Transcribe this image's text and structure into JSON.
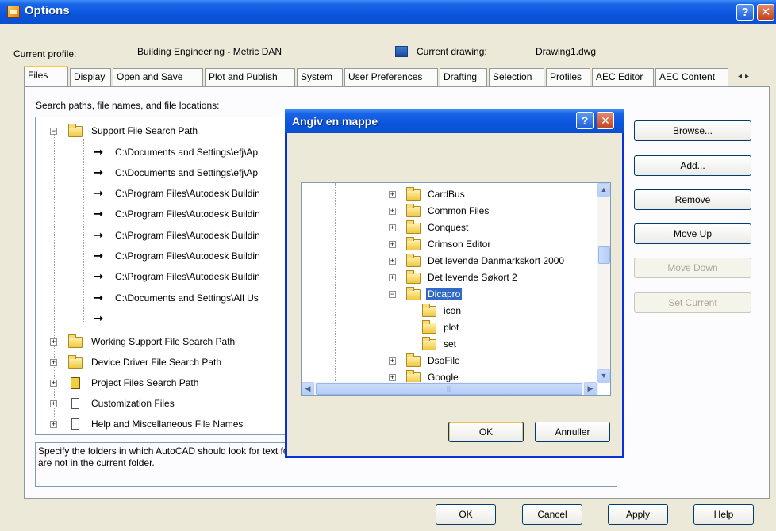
{
  "window": {
    "title": "Options"
  },
  "titlebar_buttons": {
    "help": "?",
    "close": "✕"
  },
  "profile": {
    "label": "Current profile:",
    "value": "Building Engineering - Metric DAN",
    "drawing_label": "Current drawing:",
    "drawing_value": "Drawing1.dwg"
  },
  "tabs": [
    "Files",
    "Display",
    "Open and Save",
    "Plot and Publish",
    "System",
    "User Preferences",
    "Drafting",
    "Selection",
    "Profiles",
    "AEC Editor",
    "AEC Content"
  ],
  "active_tab": "Files",
  "tab_scroll": {
    "left": "◂",
    "right": "▸"
  },
  "files": {
    "label": "Search paths, file names, and file locations:",
    "tree": {
      "support": {
        "label": "Support File Search Path",
        "paths": [
          "C:\\Documents and Settings\\efj\\Ap",
          "C:\\Documents and Settings\\efj\\Ap",
          "C:\\Program Files\\Autodesk Buildin",
          "C:\\Program Files\\Autodesk Buildin",
          "C:\\Program Files\\Autodesk Buildin",
          "C:\\Program Files\\Autodesk Buildin",
          "C:\\Program Files\\Autodesk Buildin",
          "C:\\Documents and Settings\\All Us",
          ""
        ]
      },
      "nodes": [
        "Working Support File Search Path",
        "Device Driver File Search Path",
        "Project Files Search Path",
        "Customization Files",
        "Help and Miscellaneous File Names"
      ]
    },
    "description": "Specify the folders in which AutoCAD should look for text fonts, menus, plug-ins, drawings to insert, linetypes, and hatch patterns that are not in the current folder."
  },
  "side_buttons": {
    "browse": "Browse...",
    "add": "Add...",
    "remove": "Remove",
    "move_up": "Move Up",
    "move_down": "Move Down",
    "set_current": "Set Current"
  },
  "bottom_buttons": {
    "ok": "OK",
    "cancel": "Cancel",
    "apply": "Apply",
    "help": "Help"
  },
  "dialog": {
    "title": "Angiv en mappe",
    "help": "?",
    "close": "✕",
    "folders": [
      {
        "name": "CardBus",
        "expander": "+"
      },
      {
        "name": "Common Files",
        "expander": "+"
      },
      {
        "name": "Conquest",
        "expander": "+"
      },
      {
        "name": "Crimson Editor",
        "expander": "+"
      },
      {
        "name": "Det levende Danmarkskort 2000",
        "expander": "+"
      },
      {
        "name": "Det levende Søkort 2",
        "expander": "+"
      },
      {
        "name": "Dicapro",
        "expander": "−"
      },
      {
        "name": "icon",
        "expander": ""
      },
      {
        "name": "plot",
        "expander": ""
      },
      {
        "name": "set",
        "expander": ""
      },
      {
        "name": "DsoFile",
        "expander": "+"
      },
      {
        "name": "Google",
        "expander": "+"
      }
    ],
    "selected_folder": "Dicapro",
    "ok": "OK",
    "cancel": "Annuller",
    "scroll_up": "▲",
    "scroll_down": "▼",
    "scroll_left": "◀",
    "scroll_right": "▶",
    "hthumb_grip": "|||"
  },
  "icons": {
    "folder": "folder-icon",
    "arrow": "arrow-right-icon",
    "document": "document-icon",
    "book": "book-icon"
  },
  "colors": {
    "titlebar": "#0a55dc",
    "selection": "#316ac5",
    "background": "#ece9d8"
  }
}
